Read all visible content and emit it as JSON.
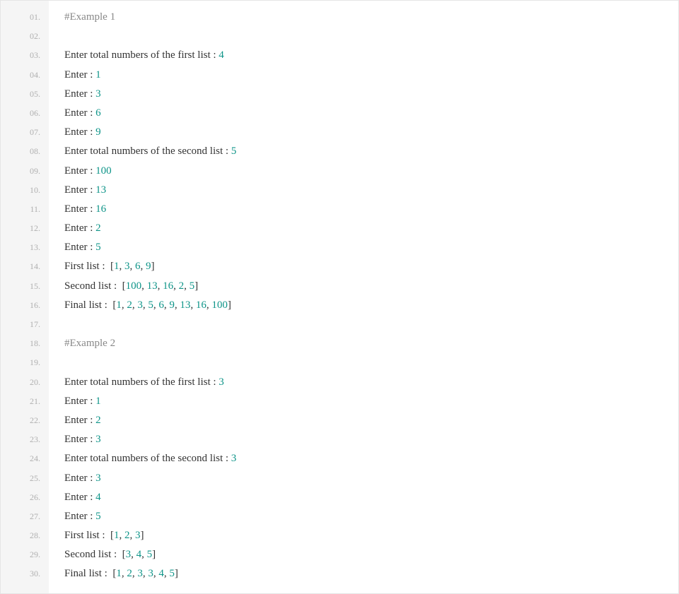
{
  "colors": {
    "gutter_bg": "#f5f5f5",
    "gutter_text": "#b0b0b0",
    "text": "#333333",
    "comment": "#888888",
    "number": "#0d9488",
    "border": "#e5e5e5"
  },
  "line_numbers": [
    "01.",
    "02.",
    "03.",
    "04.",
    "05.",
    "06.",
    "07.",
    "08.",
    "09.",
    "10.",
    "11.",
    "12.",
    "13.",
    "14.",
    "15.",
    "16.",
    "17.",
    "18.",
    "19.",
    "20.",
    "21.",
    "22.",
    "23.",
    "24.",
    "25.",
    "26.",
    "27.",
    "28.",
    "29.",
    "30."
  ],
  "lines": [
    {
      "type": "comment",
      "tokens": [
        {
          "t": "comment",
          "v": "#Example 1"
        }
      ]
    },
    {
      "type": "blank",
      "tokens": []
    },
    {
      "type": "code",
      "tokens": [
        {
          "t": "txt",
          "v": "Enter total numbers of the first list : "
        },
        {
          "t": "num",
          "v": "4"
        }
      ]
    },
    {
      "type": "code",
      "tokens": [
        {
          "t": "txt",
          "v": "Enter : "
        },
        {
          "t": "num",
          "v": "1"
        }
      ]
    },
    {
      "type": "code",
      "tokens": [
        {
          "t": "txt",
          "v": "Enter : "
        },
        {
          "t": "num",
          "v": "3"
        }
      ]
    },
    {
      "type": "code",
      "tokens": [
        {
          "t": "txt",
          "v": "Enter : "
        },
        {
          "t": "num",
          "v": "6"
        }
      ]
    },
    {
      "type": "code",
      "tokens": [
        {
          "t": "txt",
          "v": "Enter : "
        },
        {
          "t": "num",
          "v": "9"
        }
      ]
    },
    {
      "type": "code",
      "tokens": [
        {
          "t": "txt",
          "v": "Enter total numbers of the second list : "
        },
        {
          "t": "num",
          "v": "5"
        }
      ]
    },
    {
      "type": "code",
      "tokens": [
        {
          "t": "txt",
          "v": "Enter : "
        },
        {
          "t": "num",
          "v": "100"
        }
      ]
    },
    {
      "type": "code",
      "tokens": [
        {
          "t": "txt",
          "v": "Enter : "
        },
        {
          "t": "num",
          "v": "13"
        }
      ]
    },
    {
      "type": "code",
      "tokens": [
        {
          "t": "txt",
          "v": "Enter : "
        },
        {
          "t": "num",
          "v": "16"
        }
      ]
    },
    {
      "type": "code",
      "tokens": [
        {
          "t": "txt",
          "v": "Enter : "
        },
        {
          "t": "num",
          "v": "2"
        }
      ]
    },
    {
      "type": "code",
      "tokens": [
        {
          "t": "txt",
          "v": "Enter : "
        },
        {
          "t": "num",
          "v": "5"
        }
      ]
    },
    {
      "type": "code",
      "tokens": [
        {
          "t": "txt",
          "v": "First list :  ["
        },
        {
          "t": "num",
          "v": "1"
        },
        {
          "t": "txt",
          "v": ", "
        },
        {
          "t": "num",
          "v": "3"
        },
        {
          "t": "txt",
          "v": ", "
        },
        {
          "t": "num",
          "v": "6"
        },
        {
          "t": "txt",
          "v": ", "
        },
        {
          "t": "num",
          "v": "9"
        },
        {
          "t": "txt",
          "v": "]"
        }
      ]
    },
    {
      "type": "code",
      "tokens": [
        {
          "t": "txt",
          "v": "Second list :  ["
        },
        {
          "t": "num",
          "v": "100"
        },
        {
          "t": "txt",
          "v": ", "
        },
        {
          "t": "num",
          "v": "13"
        },
        {
          "t": "txt",
          "v": ", "
        },
        {
          "t": "num",
          "v": "16"
        },
        {
          "t": "txt",
          "v": ", "
        },
        {
          "t": "num",
          "v": "2"
        },
        {
          "t": "txt",
          "v": ", "
        },
        {
          "t": "num",
          "v": "5"
        },
        {
          "t": "txt",
          "v": "]"
        }
      ]
    },
    {
      "type": "code",
      "tokens": [
        {
          "t": "txt",
          "v": "Final list :  ["
        },
        {
          "t": "num",
          "v": "1"
        },
        {
          "t": "txt",
          "v": ", "
        },
        {
          "t": "num",
          "v": "2"
        },
        {
          "t": "txt",
          "v": ", "
        },
        {
          "t": "num",
          "v": "3"
        },
        {
          "t": "txt",
          "v": ", "
        },
        {
          "t": "num",
          "v": "5"
        },
        {
          "t": "txt",
          "v": ", "
        },
        {
          "t": "num",
          "v": "6"
        },
        {
          "t": "txt",
          "v": ", "
        },
        {
          "t": "num",
          "v": "9"
        },
        {
          "t": "txt",
          "v": ", "
        },
        {
          "t": "num",
          "v": "13"
        },
        {
          "t": "txt",
          "v": ", "
        },
        {
          "t": "num",
          "v": "16"
        },
        {
          "t": "txt",
          "v": ", "
        },
        {
          "t": "num",
          "v": "100"
        },
        {
          "t": "txt",
          "v": "]"
        }
      ]
    },
    {
      "type": "blank",
      "tokens": []
    },
    {
      "type": "comment",
      "tokens": [
        {
          "t": "comment",
          "v": "#Example 2"
        }
      ]
    },
    {
      "type": "blank",
      "tokens": []
    },
    {
      "type": "code",
      "tokens": [
        {
          "t": "txt",
          "v": "Enter total numbers of the first list : "
        },
        {
          "t": "num",
          "v": "3"
        }
      ]
    },
    {
      "type": "code",
      "tokens": [
        {
          "t": "txt",
          "v": "Enter : "
        },
        {
          "t": "num",
          "v": "1"
        }
      ]
    },
    {
      "type": "code",
      "tokens": [
        {
          "t": "txt",
          "v": "Enter : "
        },
        {
          "t": "num",
          "v": "2"
        }
      ]
    },
    {
      "type": "code",
      "tokens": [
        {
          "t": "txt",
          "v": "Enter : "
        },
        {
          "t": "num",
          "v": "3"
        }
      ]
    },
    {
      "type": "code",
      "tokens": [
        {
          "t": "txt",
          "v": "Enter total numbers of the second list : "
        },
        {
          "t": "num",
          "v": "3"
        }
      ]
    },
    {
      "type": "code",
      "tokens": [
        {
          "t": "txt",
          "v": "Enter : "
        },
        {
          "t": "num",
          "v": "3"
        }
      ]
    },
    {
      "type": "code",
      "tokens": [
        {
          "t": "txt",
          "v": "Enter : "
        },
        {
          "t": "num",
          "v": "4"
        }
      ]
    },
    {
      "type": "code",
      "tokens": [
        {
          "t": "txt",
          "v": "Enter : "
        },
        {
          "t": "num",
          "v": "5"
        }
      ]
    },
    {
      "type": "code",
      "tokens": [
        {
          "t": "txt",
          "v": "First list :  ["
        },
        {
          "t": "num",
          "v": "1"
        },
        {
          "t": "txt",
          "v": ", "
        },
        {
          "t": "num",
          "v": "2"
        },
        {
          "t": "txt",
          "v": ", "
        },
        {
          "t": "num",
          "v": "3"
        },
        {
          "t": "txt",
          "v": "]"
        }
      ]
    },
    {
      "type": "code",
      "tokens": [
        {
          "t": "txt",
          "v": "Second list :  ["
        },
        {
          "t": "num",
          "v": "3"
        },
        {
          "t": "txt",
          "v": ", "
        },
        {
          "t": "num",
          "v": "4"
        },
        {
          "t": "txt",
          "v": ", "
        },
        {
          "t": "num",
          "v": "5"
        },
        {
          "t": "txt",
          "v": "]"
        }
      ]
    },
    {
      "type": "code",
      "tokens": [
        {
          "t": "txt",
          "v": "Final list :  ["
        },
        {
          "t": "num",
          "v": "1"
        },
        {
          "t": "txt",
          "v": ", "
        },
        {
          "t": "num",
          "v": "2"
        },
        {
          "t": "txt",
          "v": ", "
        },
        {
          "t": "num",
          "v": "3"
        },
        {
          "t": "txt",
          "v": ", "
        },
        {
          "t": "num",
          "v": "3"
        },
        {
          "t": "txt",
          "v": ", "
        },
        {
          "t": "num",
          "v": "4"
        },
        {
          "t": "txt",
          "v": ", "
        },
        {
          "t": "num",
          "v": "5"
        },
        {
          "t": "txt",
          "v": "]"
        }
      ]
    }
  ]
}
